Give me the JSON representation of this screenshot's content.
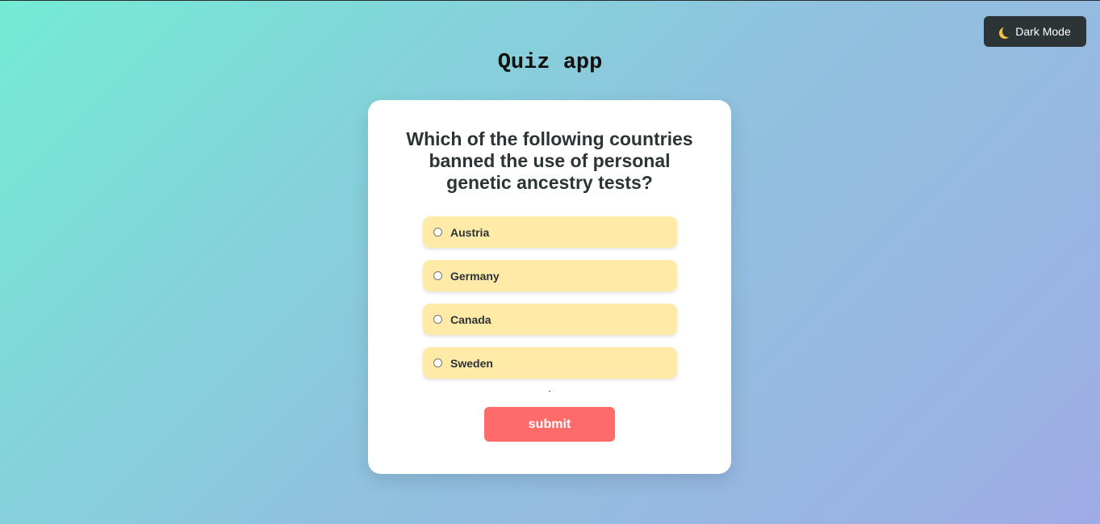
{
  "header": {
    "title": "Quiz app",
    "dark_mode_label": "Dark Mode",
    "dark_mode_icon": "moon-icon"
  },
  "quiz": {
    "question": "Which of the following countries banned the use of personal genetic ancestry tests?",
    "options": [
      {
        "label": "Austria",
        "selected": false
      },
      {
        "label": "Germany",
        "selected": false
      },
      {
        "label": "Canada",
        "selected": false
      },
      {
        "label": "Sweden",
        "selected": false
      }
    ],
    "submit_label": "submit"
  },
  "colors": {
    "background_start": "#74ebd5",
    "background_end": "#9face6",
    "card": "#ffffff",
    "option_bg": "#ffeaa7",
    "submit_bg": "#ff6b6b",
    "dark_button_bg": "#2d3436"
  }
}
